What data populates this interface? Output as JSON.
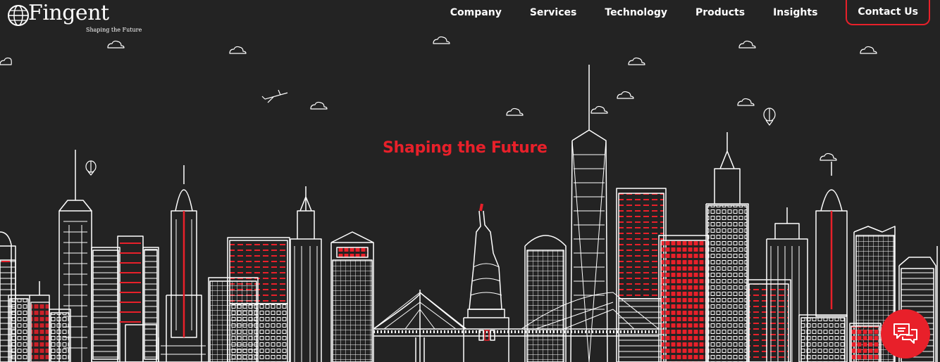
{
  "brand": {
    "name": "Fingent",
    "tagline": "Shaping the Future",
    "accent_color": "#e8202a",
    "background_color": "#232323"
  },
  "nav": {
    "items": [
      {
        "label": "Company"
      },
      {
        "label": "Services"
      },
      {
        "label": "Technology"
      },
      {
        "label": "Products"
      },
      {
        "label": "Insights"
      }
    ],
    "contact_label": "Contact Us"
  },
  "hero": {
    "title": "Shaping the Future",
    "illustration": "new-york-city-skyline-line-art"
  },
  "chat": {
    "icon": "chat-bubbles-icon"
  }
}
